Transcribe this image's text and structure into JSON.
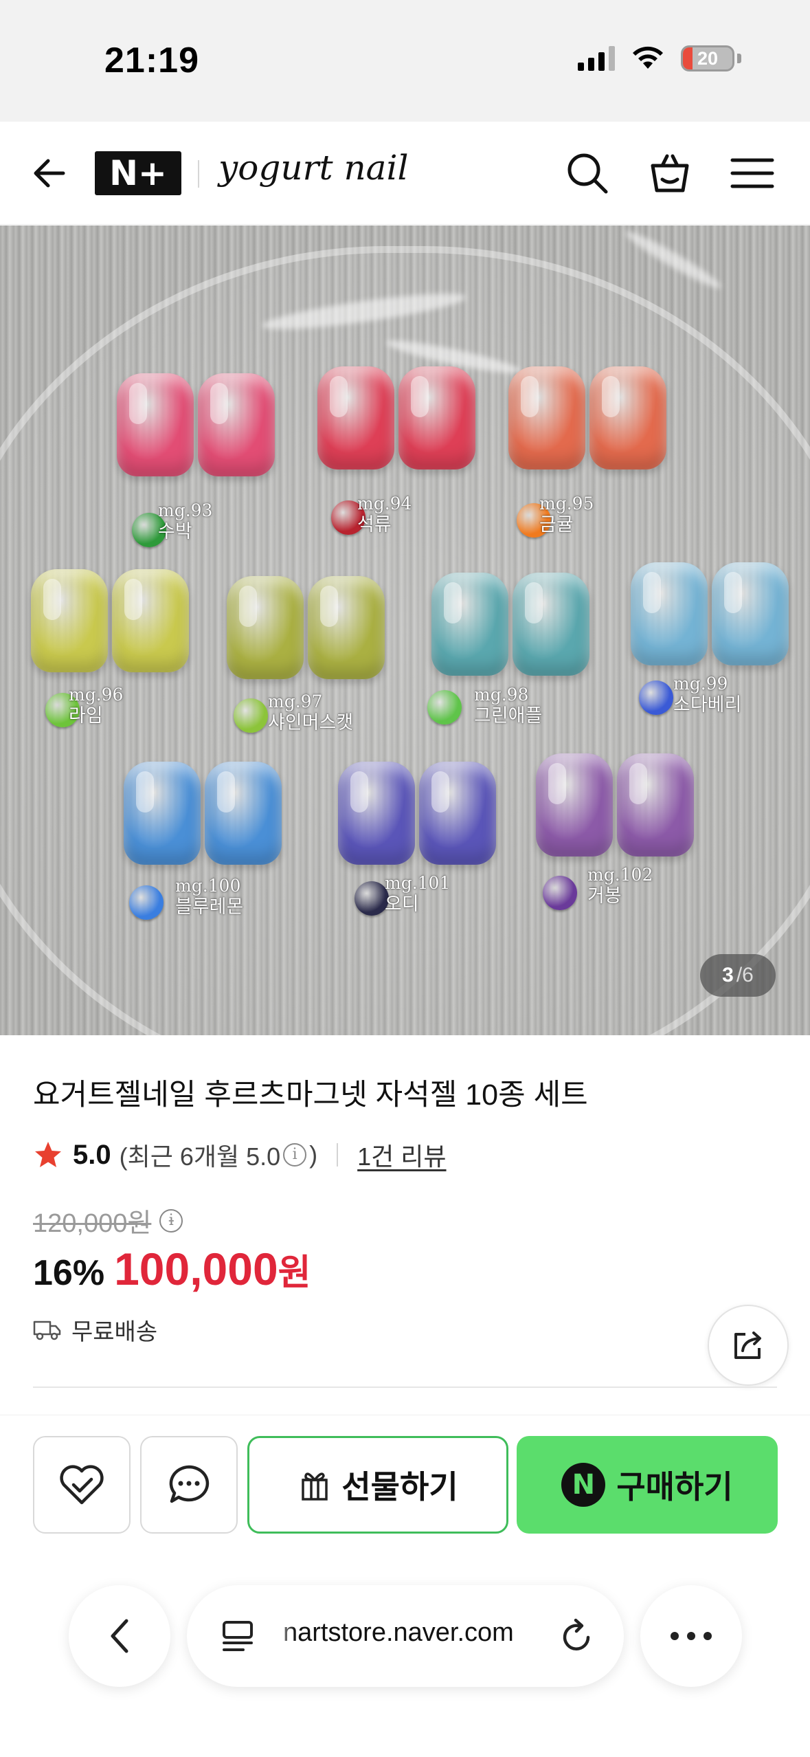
{
  "status_bar": {
    "time": "21:19",
    "battery": "20",
    "battery_level": 0.2
  },
  "header": {
    "logo_text": "N+",
    "brand": "yogurt nail"
  },
  "gallery": {
    "current_page": "3",
    "total_pages": "/6",
    "items": [
      {
        "code": "mg.93",
        "name": "수박",
        "color": "#e24d74"
      },
      {
        "code": "mg.94",
        "name": "석류",
        "color": "#de3f56"
      },
      {
        "code": "mg.95",
        "name": "금귤",
        "color": "#e36a4d"
      },
      {
        "code": "mg.96",
        "name": "라임",
        "color": "#c9c94e"
      },
      {
        "code": "mg.97",
        "name": "샤인머스캣",
        "color": "#aab042"
      },
      {
        "code": "mg.98",
        "name": "그린애플",
        "color": "#5aa7ae"
      },
      {
        "code": "mg.99",
        "name": "소다베리",
        "color": "#74b3d4"
      },
      {
        "code": "mg.100",
        "name": "블루레몬",
        "color": "#4a8fd6"
      },
      {
        "code": "mg.101",
        "name": "오디",
        "color": "#5a55b8"
      },
      {
        "code": "mg.102",
        "name": "거봉",
        "color": "#8c5aa8"
      }
    ]
  },
  "product": {
    "title": "요거트젤네일 후르츠마그넷 자석젤 10종 세트",
    "rating": "5.0",
    "rating_recent": "(최근 6개월 5.0",
    "rating_recent_close": ")",
    "review_count": "1건 리뷰",
    "original_price": "120,000원",
    "discount": "16%",
    "sale_price": "100,000",
    "currency": "원",
    "delivery": "무료배송"
  },
  "actions": {
    "gift_label": "선물하기",
    "buy_label": "구매하기",
    "buy_badge": "N"
  },
  "browser": {
    "url": "nartstore.naver.com"
  },
  "colors": {
    "accent_green": "#5bdd6c",
    "sale_red": "#e0263a",
    "star": "#e8402f"
  }
}
